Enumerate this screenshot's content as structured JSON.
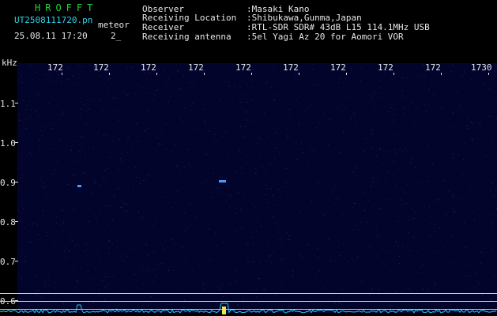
{
  "header": {
    "logo": "HROFFT",
    "filename": "UT2508111720.pn",
    "file_type": "meteor",
    "timestamp": "25.08.11 17:20",
    "slot": "2_",
    "meta": [
      {
        "label": "Observer",
        "value": ":Masaki Kano"
      },
      {
        "label": "Receiving Location",
        "value": ":Shibukawa,Gunma,Japan"
      },
      {
        "label": "Receiver",
        "value": ":RTL-SDR SDR# 43dB L15 114.1MHz USB"
      },
      {
        "label": "Receiving antenna",
        "value": ":5el Yagi Az 20 for Aomori VOR"
      }
    ]
  },
  "axes": {
    "y_unit": "kHz",
    "y_ticks": [
      "1.1",
      "1.0",
      "0.9",
      "0.8",
      "0.7",
      "0.6"
    ],
    "x_ticks": [
      "172",
      "172",
      "172",
      "172",
      "172",
      "172",
      "172",
      "172",
      "172",
      "1730"
    ]
  },
  "colors": {
    "background": "#000000",
    "plot": "#03042c",
    "logo": "#1fd43a",
    "filename": "#2fd2e8",
    "text": "#e6e6e6",
    "spectrum": "#29c8f0",
    "echo": "#4a9bff"
  }
}
